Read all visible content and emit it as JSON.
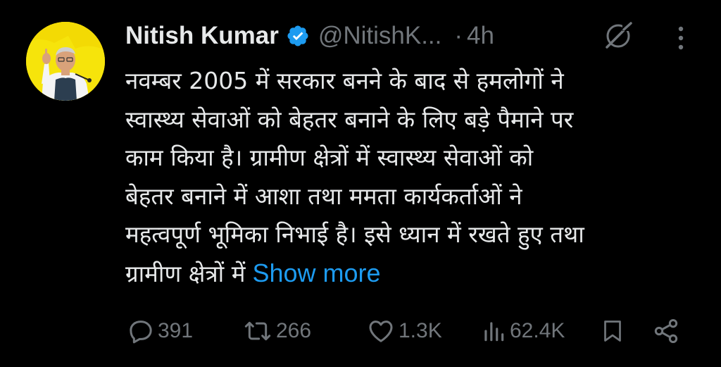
{
  "author": {
    "display_name": "Nitish Kumar",
    "handle": "@NitishK...",
    "separator": "·",
    "time": "4h",
    "verified": true
  },
  "tweet": {
    "lines": [
      "नवम्बर 2005 में सरकार बनने के बाद से हमलोगों ने",
      "स्वास्थ्य सेवाओं को बेहतर बनाने के लिए बड़े पैमाने पर",
      "काम किया है। ग्रामीण क्षेत्रों में स्वास्थ्य सेवाओं को",
      "बेहतर बनाने में आशा तथा ममता कार्यकर्ताओं ने",
      "महत्वपूर्ण भूमिका निभाई है। इसे ध्यान में रखते हुए तथा",
      "ग्रामीण क्षेत्रों में"
    ],
    "show_more": "Show more"
  },
  "actions": {
    "replies": "391",
    "reposts": "266",
    "likes": "1.3K",
    "views": "62.4K"
  },
  "colors": {
    "background": "#000000",
    "text": "#e7e9ea",
    "muted": "#71767b",
    "link": "#1d9bf0",
    "verified": "#1d9bf0",
    "avatar_bg": "#f6e40b"
  },
  "icons": [
    "verified-badge-icon",
    "grok-icon",
    "more-icon",
    "reply-icon",
    "repost-icon",
    "like-icon",
    "views-icon",
    "bookmark-icon",
    "share-icon"
  ]
}
